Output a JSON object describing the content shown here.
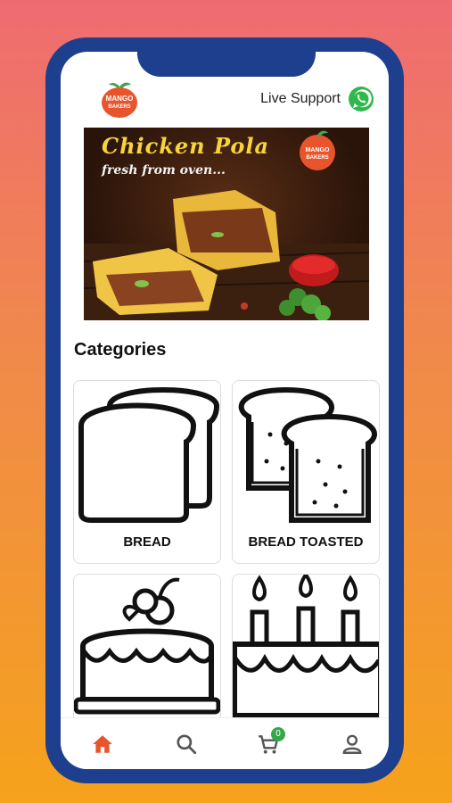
{
  "header": {
    "brand_line1": "MANGO",
    "brand_line2": "BAKERS",
    "support_label": "Live Support"
  },
  "banner": {
    "title": "Chicken Pola",
    "subtitle": "fresh from oven..."
  },
  "categories": {
    "title": "Categories",
    "items": [
      {
        "label": "BREAD"
      },
      {
        "label": "BREAD TOASTED"
      },
      {
        "label": ""
      },
      {
        "label": ""
      }
    ]
  },
  "nav": {
    "cart_count": "0",
    "active_color": "#e8542b"
  }
}
